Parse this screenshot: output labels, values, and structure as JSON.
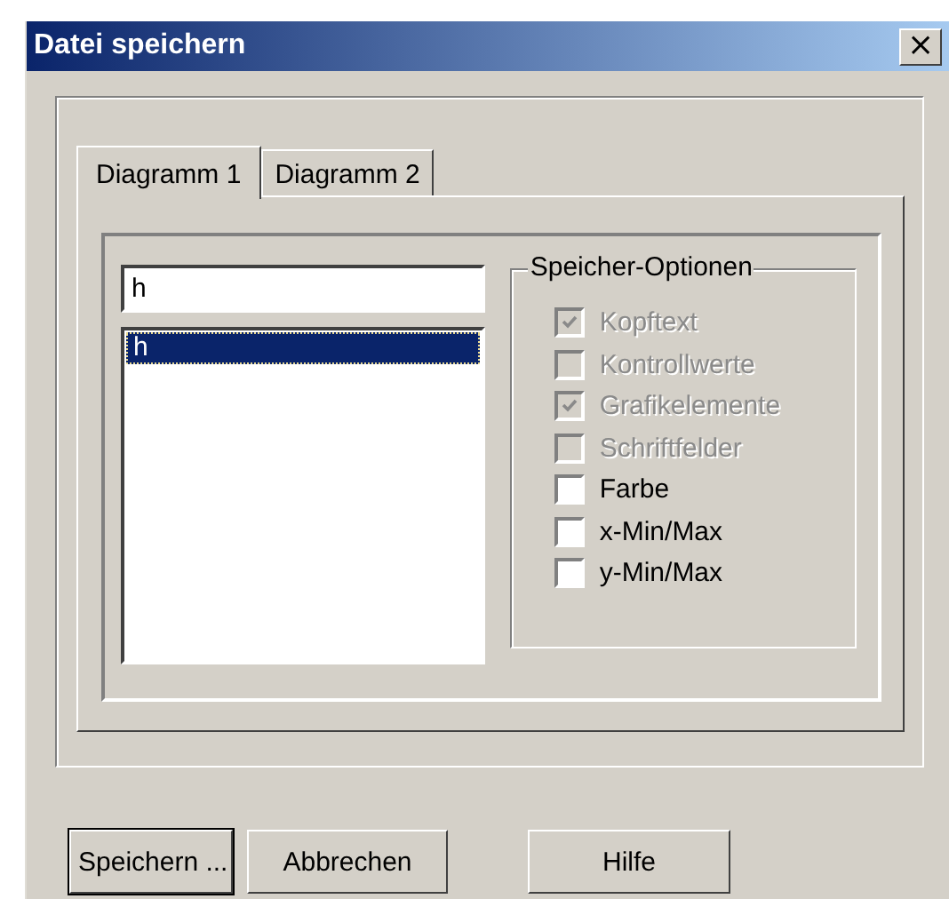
{
  "window": {
    "title": "Datei speichern",
    "close": "×"
  },
  "tabs": [
    {
      "label": "Diagramm 1",
      "selected": true
    },
    {
      "label": "Diagramm 2",
      "selected": false
    }
  ],
  "name_field": {
    "value": "h"
  },
  "list": {
    "items": [
      {
        "label": "h",
        "selected": true
      }
    ]
  },
  "options": {
    "title": "Speicher-Optionen",
    "items": [
      {
        "label": "Kopftext",
        "checked": true,
        "disabled": true
      },
      {
        "label": "Kontrollwerte",
        "checked": false,
        "disabled": true
      },
      {
        "label": "Grafikelemente",
        "checked": true,
        "disabled": true
      },
      {
        "label": "Schriftfelder",
        "checked": false,
        "disabled": true
      },
      {
        "label": "Farbe",
        "checked": false,
        "disabled": false
      },
      {
        "label": "x-Min/Max",
        "checked": false,
        "disabled": false
      },
      {
        "label": "y-Min/Max",
        "checked": false,
        "disabled": false
      }
    ]
  },
  "buttons": [
    {
      "label": "Speichern ...",
      "default": true
    },
    {
      "label": "Abbrechen",
      "default": false
    },
    {
      "label": "Hilfe",
      "default": false
    }
  ]
}
